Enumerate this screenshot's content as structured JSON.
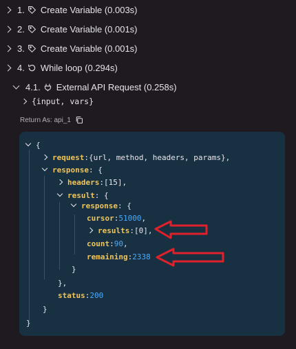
{
  "steps": [
    {
      "num": "1.",
      "label": "Create Variable (0.003s)",
      "icon": "tag-icon"
    },
    {
      "num": "2.",
      "label": "Create Variable (0.001s)",
      "icon": "tag-icon"
    },
    {
      "num": "3.",
      "label": "Create Variable (0.001s)",
      "icon": "tag-icon"
    },
    {
      "num": "4.",
      "label": "While loop (0.294s)",
      "icon": "loop-icon"
    }
  ],
  "substep": {
    "num": "4.1.",
    "label": "External API Request (0.258s)",
    "icon": "plug-icon"
  },
  "input_vars": "{input, vars}",
  "return_as": "Return As: api_1",
  "code": {
    "open_brace": "{",
    "request_key": "request",
    "request_val": "{url, method, headers, params},",
    "response_key": "response",
    "brace_open": ": {",
    "headers_key": "headers",
    "headers_val": "[15],",
    "result_key": "result",
    "inner_response_key": "response",
    "cursor_key": "cursor",
    "cursor_val": "51000",
    "results_key": "results",
    "results_val": "[0],",
    "count_key": "count",
    "count_val": "90",
    "remaining_key": "remaining",
    "remaining_val": "2338",
    "close_brace": "}",
    "close_brace_comma": "},",
    "status_key": "status",
    "status_val": "200",
    "comma": ",",
    "colon": ": "
  },
  "colors": {
    "background": "#1f1a20",
    "panel": "#173142",
    "key": "#f0c45a",
    "number": "#4aa9ff",
    "arrow": "#e0202a"
  }
}
